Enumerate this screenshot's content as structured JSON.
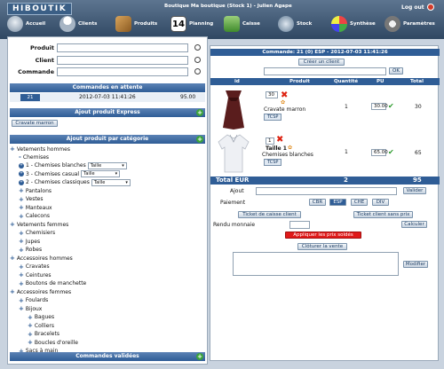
{
  "app": {
    "logo": "HIBOUTIK",
    "shop_title": "Boutique Ma boutique (Stock 1) - Julien Agape",
    "logout_label": "Log out"
  },
  "nav": [
    {
      "label": "Accueil",
      "icon": "home-icon"
    },
    {
      "label": "Clients",
      "icon": "clients-icon"
    },
    {
      "label": "Produits",
      "icon": "products-icon"
    },
    {
      "label": "Planning",
      "icon": "calendar-icon",
      "icon_text": "14"
    },
    {
      "label": "Caisse",
      "icon": "cash-icon"
    },
    {
      "label": "Stock",
      "icon": "stock-icon"
    },
    {
      "label": "Synthèse",
      "icon": "chart-icon"
    },
    {
      "label": "Paramètres",
      "icon": "settings-icon"
    }
  ],
  "search": {
    "produit_label": "Produit",
    "client_label": "Client",
    "commande_label": "Commande"
  },
  "sections": {
    "pending_title": "Commandes en attente",
    "express_title": "Ajout produit Express",
    "category_title": "Ajout produit par catégorie",
    "validated_title": "Commandes validées"
  },
  "pending_order": {
    "id": "21",
    "datetime": "2012-07-03 11:41:26",
    "amount": "95.00"
  },
  "express_button": "Cravate marron",
  "tree": [
    {
      "label": "Vetements hommes",
      "level": 0,
      "kind": "plus"
    },
    {
      "label": "Chemises",
      "level": 1,
      "kind": "dash"
    },
    {
      "label": "1 - Chemises blanches",
      "level": 1,
      "kind": "num",
      "num": "1",
      "select": "Taille"
    },
    {
      "label": "3 - Chemises casual",
      "level": 1,
      "kind": "num",
      "num": "3",
      "select": "Taille"
    },
    {
      "label": "2 - Chemises classiques",
      "level": 1,
      "kind": "num",
      "num": "2",
      "select": "Taille"
    },
    {
      "label": "Pantalons",
      "level": 1,
      "kind": "plus"
    },
    {
      "label": "Vestes",
      "level": 1,
      "kind": "plus"
    },
    {
      "label": "Manteaux",
      "level": 1,
      "kind": "plus"
    },
    {
      "label": "Calecons",
      "level": 1,
      "kind": "plus"
    },
    {
      "label": "Vetements femmes",
      "level": 0,
      "kind": "plus"
    },
    {
      "label": "Chemisiers",
      "level": 1,
      "kind": "plus"
    },
    {
      "label": "Jupes",
      "level": 1,
      "kind": "plus"
    },
    {
      "label": "Robes",
      "level": 1,
      "kind": "plus"
    },
    {
      "label": "Accessoires hommes",
      "level": 0,
      "kind": "plus"
    },
    {
      "label": "Cravates",
      "level": 1,
      "kind": "plus"
    },
    {
      "label": "Ceintures",
      "level": 1,
      "kind": "plus"
    },
    {
      "label": "Boutons de manchette",
      "level": 1,
      "kind": "plus"
    },
    {
      "label": "Accessoires femmes",
      "level": 0,
      "kind": "plus"
    },
    {
      "label": "Foulards",
      "level": 1,
      "kind": "plus"
    },
    {
      "label": "Bijoux",
      "level": 1,
      "kind": "plus"
    },
    {
      "label": "Bagues",
      "level": 2,
      "kind": "plus"
    },
    {
      "label": "Colliers",
      "level": 2,
      "kind": "plus"
    },
    {
      "label": "Bracelets",
      "level": 2,
      "kind": "plus"
    },
    {
      "label": "Boucles d'oreille",
      "level": 2,
      "kind": "plus"
    },
    {
      "label": "Sacs à main",
      "level": 1,
      "kind": "plus"
    }
  ],
  "order": {
    "header": "Commande: 21 (0) ESP - 2012-07-03 11:41:26",
    "create_client_button": "Créer un client",
    "ok_button": "OK",
    "columns": [
      "id",
      "Produit",
      "Quantité",
      "PU",
      "Total"
    ],
    "lines": [
      {
        "id": "30",
        "name": "Cravate marron",
        "size": "",
        "qty": "1",
        "pu": "30.00",
        "total": "30",
        "tcsp": "TCSP"
      },
      {
        "id": "1",
        "name": "Chemises blanches",
        "size": "Taille 1",
        "qty": "1",
        "pu": "65.00",
        "total": "65",
        "tcsp": "TCSP"
      }
    ],
    "total": {
      "label": "Total EUR",
      "qty": "2",
      "amount": "95"
    },
    "ajout_label": "Ajout",
    "valider_button": "Valider",
    "paiement_label": "Paiement",
    "payment_methods": [
      "CBR",
      "ESP",
      "CHE",
      "DIV"
    ],
    "active_payment": "ESP",
    "ticket_client_button": "Ticket de caisse client",
    "ticket_no_price_button": "Ticket client sans prix",
    "rendu_label": "Rendu monnaie",
    "calculer_button": "Calculer",
    "apply_sales_button": "Appliquer les prix soldés",
    "close_sale_button": "Clôturer la vente",
    "modifier_button": "Modifier"
  },
  "colors": {
    "header_blue": "#2f5d96",
    "accent_red": "#e01a1a",
    "ok_green": "#2b9a2b"
  }
}
